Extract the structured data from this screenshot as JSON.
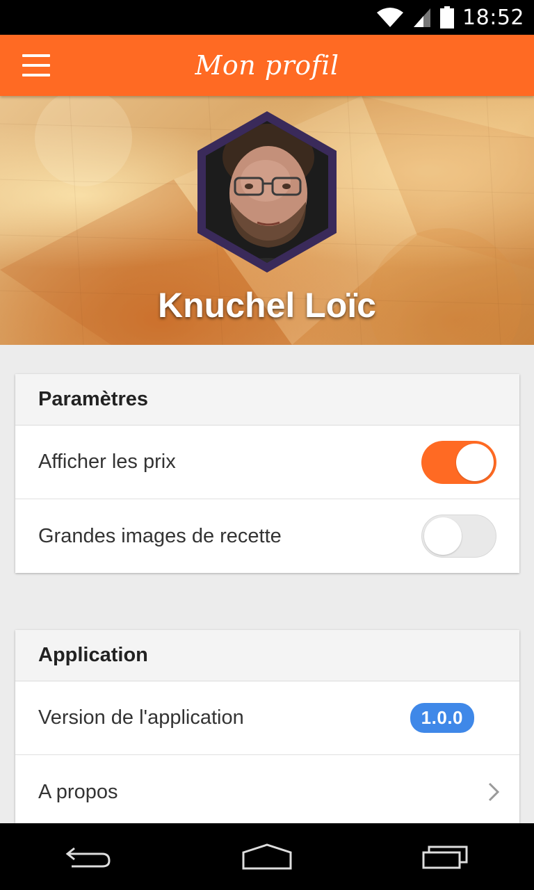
{
  "status_bar": {
    "time": "18:52"
  },
  "app_bar": {
    "title": "Mon profil"
  },
  "profile": {
    "name": "Knuchel Loïc"
  },
  "settings_card": {
    "title": "Paramètres",
    "rows": [
      {
        "label": "Afficher les prix",
        "toggle_on": true
      },
      {
        "label": "Grandes images de recette",
        "toggle_on": false
      }
    ]
  },
  "app_card": {
    "title": "Application",
    "version_label": "Version de l'application",
    "version_value": "1.0.0",
    "about_label": "A propos"
  },
  "colors": {
    "accent": "#ff6a23",
    "badge": "#3f88e8",
    "hexagon_border": "#3a2a5a"
  },
  "icons": {
    "menu": "hamburger-menu-icon",
    "wifi": "wifi-icon",
    "signal": "cell-signal-icon",
    "battery": "battery-icon",
    "chevron": "chevron-right-icon",
    "back": "back-icon",
    "home": "home-icon",
    "recents": "recents-icon"
  }
}
